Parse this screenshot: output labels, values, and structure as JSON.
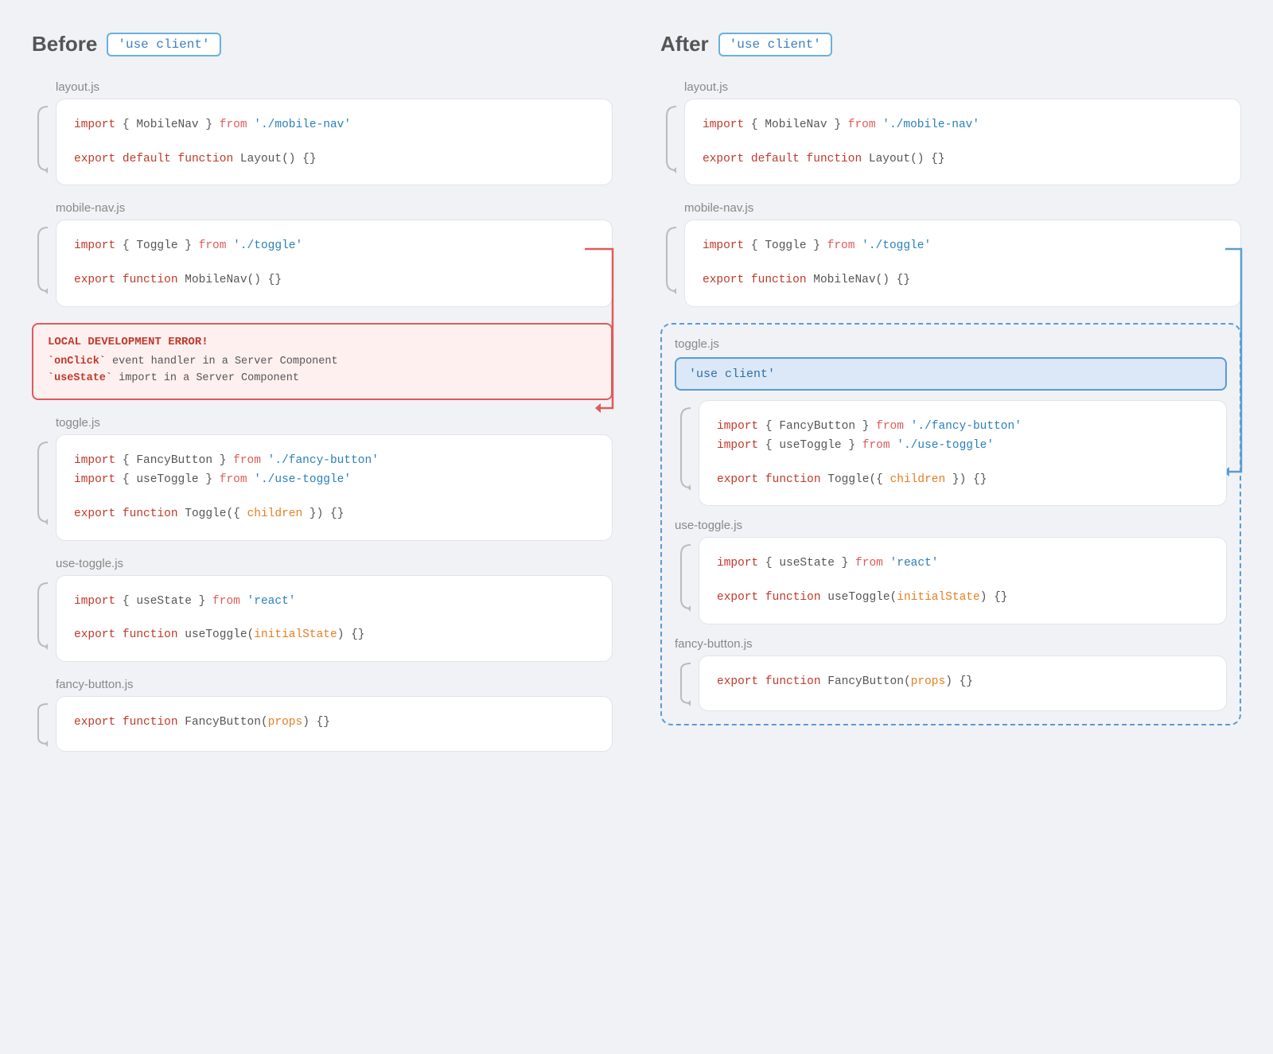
{
  "before": {
    "title": "Before",
    "badge": "'use client'",
    "files": [
      {
        "name": "layout.js",
        "lines": [
          {
            "parts": [
              {
                "text": "import",
                "class": "kw-import"
              },
              {
                "text": " { MobileNav } ",
                "class": "gray-text"
              },
              {
                "text": "from",
                "class": "kw-from"
              },
              {
                "text": " './mobile-nav'",
                "class": "str"
              }
            ]
          },
          {
            "parts": [
              {
                "text": "export",
                "class": "kw-export"
              },
              {
                "text": " ",
                "class": ""
              },
              {
                "text": "default",
                "class": "kw-default"
              },
              {
                "text": " ",
                "class": ""
              },
              {
                "text": "function",
                "class": "kw-function"
              },
              {
                "text": " Layout() {}",
                "class": "gray-text"
              }
            ]
          }
        ]
      },
      {
        "name": "mobile-nav.js",
        "lines": [
          {
            "parts": [
              {
                "text": "import",
                "class": "kw-import"
              },
              {
                "text": " { Toggle } ",
                "class": "gray-text"
              },
              {
                "text": "from",
                "class": "kw-from"
              },
              {
                "text": " './toggle'",
                "class": "str"
              }
            ]
          },
          {
            "parts": [
              {
                "text": "export",
                "class": "kw-export"
              },
              {
                "text": " ",
                "class": ""
              },
              {
                "text": "function",
                "class": "kw-function"
              },
              {
                "text": " MobileNav() {}",
                "class": "gray-text"
              }
            ]
          }
        ]
      }
    ],
    "error": {
      "title": "LOCAL DEVELOPMENT ERROR!",
      "lines": [
        "`onClick` event handler in a Server Component",
        "`useState` import in a Server Component"
      ]
    },
    "files2": [
      {
        "name": "toggle.js",
        "lines": [
          {
            "parts": [
              {
                "text": "import",
                "class": "kw-import"
              },
              {
                "text": " { FancyButton } ",
                "class": "gray-text"
              },
              {
                "text": "from",
                "class": "kw-from"
              },
              {
                "text": " './fancy-button'",
                "class": "str"
              }
            ]
          },
          {
            "parts": [
              {
                "text": "import",
                "class": "kw-import"
              },
              {
                "text": " { useToggle } ",
                "class": "gray-text"
              },
              {
                "text": "from",
                "class": "kw-from"
              },
              {
                "text": " './use-toggle'",
                "class": "str"
              }
            ]
          },
          {
            "parts": [
              {
                "text": "export",
                "class": "kw-export"
              },
              {
                "text": " ",
                "class": ""
              },
              {
                "text": "function",
                "class": "kw-function"
              },
              {
                "text": " Toggle({ ",
                "class": "gray-text"
              },
              {
                "text": "children",
                "class": "str-orange"
              },
              {
                "text": " }) {}",
                "class": "gray-text"
              }
            ]
          }
        ]
      },
      {
        "name": "use-toggle.js",
        "lines": [
          {
            "parts": [
              {
                "text": "import",
                "class": "kw-import"
              },
              {
                "text": " { useState } ",
                "class": "gray-text"
              },
              {
                "text": "from",
                "class": "kw-from"
              },
              {
                "text": " 'react'",
                "class": "str"
              }
            ]
          },
          {
            "parts": [
              {
                "text": "export",
                "class": "kw-export"
              },
              {
                "text": " ",
                "class": ""
              },
              {
                "text": "function",
                "class": "kw-function"
              },
              {
                "text": " useToggle(",
                "class": "gray-text"
              },
              {
                "text": "initialState",
                "class": "str-orange"
              },
              {
                "text": ") {}",
                "class": "gray-text"
              }
            ]
          }
        ]
      },
      {
        "name": "fancy-button.js",
        "lines": [
          {
            "parts": [
              {
                "text": "export",
                "class": "kw-export"
              },
              {
                "text": " ",
                "class": ""
              },
              {
                "text": "function",
                "class": "kw-function"
              },
              {
                "text": " FancyButton(",
                "class": "gray-text"
              },
              {
                "text": "props",
                "class": "str-orange"
              },
              {
                "text": ") {}",
                "class": "gray-text"
              }
            ]
          }
        ]
      }
    ]
  },
  "after": {
    "title": "After",
    "badge": "'use client'",
    "files": [
      {
        "name": "layout.js",
        "lines": [
          {
            "parts": [
              {
                "text": "import",
                "class": "kw-import"
              },
              {
                "text": " { MobileNav } ",
                "class": "gray-text"
              },
              {
                "text": "from",
                "class": "kw-from"
              },
              {
                "text": " './mobile-nav'",
                "class": "str"
              }
            ]
          },
          {
            "parts": [
              {
                "text": "export",
                "class": "kw-export"
              },
              {
                "text": " ",
                "class": ""
              },
              {
                "text": "default",
                "class": "kw-default"
              },
              {
                "text": " ",
                "class": ""
              },
              {
                "text": "function",
                "class": "kw-function"
              },
              {
                "text": " Layout() {}",
                "class": "gray-text"
              }
            ]
          }
        ]
      },
      {
        "name": "mobile-nav.js",
        "lines": [
          {
            "parts": [
              {
                "text": "import",
                "class": "kw-import"
              },
              {
                "text": " { Toggle } ",
                "class": "gray-text"
              },
              {
                "text": "from",
                "class": "kw-from"
              },
              {
                "text": " './toggle'",
                "class": "str"
              }
            ]
          },
          {
            "parts": [
              {
                "text": "export",
                "class": "kw-export"
              },
              {
                "text": " ",
                "class": ""
              },
              {
                "text": "function",
                "class": "kw-function"
              },
              {
                "text": " MobileNav() {}",
                "class": "gray-text"
              }
            ]
          }
        ]
      }
    ],
    "toggle_use_client": "'use client'",
    "toggle": {
      "name": "toggle.js",
      "use_client": "'use client'",
      "lines": [
        {
          "parts": [
            {
              "text": "import",
              "class": "kw-import"
            },
            {
              "text": " { FancyButton } ",
              "class": "gray-text"
            },
            {
              "text": "from",
              "class": "kw-from"
            },
            {
              "text": " './fancy-button'",
              "class": "str"
            }
          ]
        },
        {
          "parts": [
            {
              "text": "import",
              "class": "kw-import"
            },
            {
              "text": " { useToggle } ",
              "class": "gray-text"
            },
            {
              "text": "from",
              "class": "kw-from"
            },
            {
              "text": " './use-toggle'",
              "class": "str"
            }
          ]
        },
        {
          "parts": [
            {
              "text": "export",
              "class": "kw-export"
            },
            {
              "text": " ",
              "class": ""
            },
            {
              "text": "function",
              "class": "kw-function"
            },
            {
              "text": " Toggle({ ",
              "class": "gray-text"
            },
            {
              "text": "children",
              "class": "str-orange"
            },
            {
              "text": " }) {}",
              "class": "gray-text"
            }
          ]
        }
      ]
    },
    "use_toggle": {
      "name": "use-toggle.js",
      "lines": [
        {
          "parts": [
            {
              "text": "import",
              "class": "kw-import"
            },
            {
              "text": " { useState } ",
              "class": "gray-text"
            },
            {
              "text": "from",
              "class": "kw-from"
            },
            {
              "text": " 'react'",
              "class": "str"
            }
          ]
        },
        {
          "parts": [
            {
              "text": "export",
              "class": "kw-export"
            },
            {
              "text": " ",
              "class": ""
            },
            {
              "text": "function",
              "class": "kw-function"
            },
            {
              "text": " useToggle(",
              "class": "gray-text"
            },
            {
              "text": "initialState",
              "class": "str-orange"
            },
            {
              "text": ") {}",
              "class": "gray-text"
            }
          ]
        }
      ]
    },
    "fancy_button": {
      "name": "fancy-button.js",
      "lines": [
        {
          "parts": [
            {
              "text": "export",
              "class": "kw-export"
            },
            {
              "text": " ",
              "class": ""
            },
            {
              "text": "function",
              "class": "kw-function"
            },
            {
              "text": " FancyButton(",
              "class": "gray-text"
            },
            {
              "text": "props",
              "class": "str-orange"
            },
            {
              "text": ") {}",
              "class": "gray-text"
            }
          ]
        }
      ]
    }
  }
}
